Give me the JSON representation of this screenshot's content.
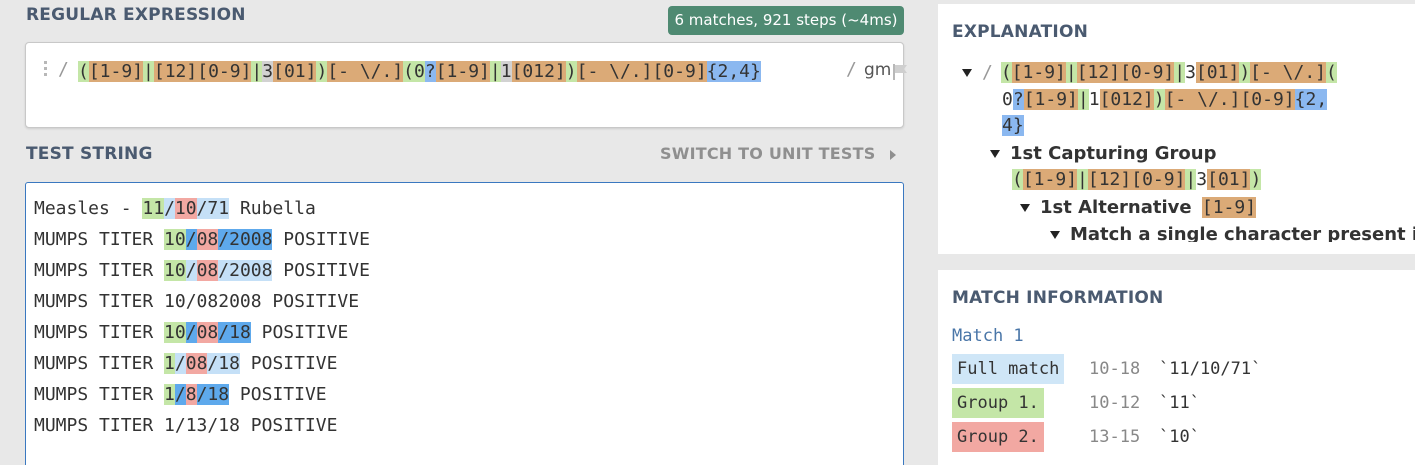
{
  "regex": {
    "title": "REGULAR EXPRESSION",
    "match_badge": "6 matches, 921 steps (~4ms)",
    "delim_open": "/",
    "delim_close": "/",
    "flags": "gm",
    "pattern_parts": [
      {
        "t": "(",
        "c": "g"
      },
      {
        "t": "[1-9]",
        "c": "o"
      },
      {
        "t": "|",
        "c": "g"
      },
      {
        "t": "[12]",
        "c": "o"
      },
      {
        "t": "[0-9]",
        "c": "o"
      },
      {
        "t": "|",
        "c": "g"
      },
      {
        "t": "3",
        "c": "x"
      },
      {
        "t": "[01]",
        "c": "o"
      },
      {
        "t": ")",
        "c": "g"
      },
      {
        "t": "[- \\/.]",
        "c": "o"
      },
      {
        "t": "(",
        "c": "g"
      },
      {
        "t": "0",
        "c": "g"
      },
      {
        "t": "?",
        "c": "b"
      },
      {
        "t": "[1-9]",
        "c": "o"
      },
      {
        "t": "|",
        "c": "g"
      },
      {
        "t": "1",
        "c": "x"
      },
      {
        "t": "[012]",
        "c": "o"
      },
      {
        "t": ")",
        "c": "g"
      },
      {
        "t": "[- \\/.]",
        "c": "o"
      },
      {
        "t": "[0-9]",
        "c": "o"
      },
      {
        "t": "{2,4}",
        "c": "b"
      }
    ]
  },
  "test": {
    "title": "TEST STRING",
    "switch_label": "SWITCH TO UNIT TESTS",
    "lines": [
      [
        {
          "t": "Measles - "
        },
        {
          "t": "11",
          "c": "g"
        },
        {
          "t": "/",
          "c": "lb"
        },
        {
          "t": "10",
          "c": "r"
        },
        {
          "t": "/71",
          "c": "lb"
        },
        {
          "t": " Rubella"
        }
      ],
      [
        {
          "t": "MUMPS TITER "
        },
        {
          "t": "10",
          "c": "g"
        },
        {
          "t": "/",
          "c": "mb"
        },
        {
          "t": "08",
          "c": "r"
        },
        {
          "t": "/2008",
          "c": "mb"
        },
        {
          "t": " POSITIVE"
        }
      ],
      [
        {
          "t": "MUMPS TITER "
        },
        {
          "t": "10",
          "c": "g"
        },
        {
          "t": "/",
          "c": "lb"
        },
        {
          "t": "08",
          "c": "r"
        },
        {
          "t": "/2008",
          "c": "lb"
        },
        {
          "t": " POSITIVE"
        }
      ],
      [
        {
          "t": "MUMPS TITER 10/082008 POSITIVE"
        }
      ],
      [
        {
          "t": "MUMPS TITER "
        },
        {
          "t": "10",
          "c": "g"
        },
        {
          "t": "/",
          "c": "mb"
        },
        {
          "t": "08",
          "c": "r"
        },
        {
          "t": "/18",
          "c": "mb"
        },
        {
          "t": " POSITIVE"
        }
      ],
      [
        {
          "t": "MUMPS TITER "
        },
        {
          "t": "1",
          "c": "g"
        },
        {
          "t": "/",
          "c": "lb"
        },
        {
          "t": "08",
          "c": "r"
        },
        {
          "t": "/18",
          "c": "lb"
        },
        {
          "t": " POSITIVE"
        }
      ],
      [
        {
          "t": "MUMPS TITER "
        },
        {
          "t": "1",
          "c": "g"
        },
        {
          "t": "/",
          "c": "mb"
        },
        {
          "t": "8",
          "c": "r"
        },
        {
          "t": "/18",
          "c": "mb"
        },
        {
          "t": " POSITIVE"
        }
      ],
      [
        {
          "t": "MUMPS TITER 1/13/18 POSITIVE"
        }
      ]
    ]
  },
  "explanation": {
    "title": "EXPLANATION",
    "slash": "/",
    "pattern_line1": [
      {
        "t": "(",
        "c": "g"
      },
      {
        "t": "[1-9]",
        "c": "o"
      },
      {
        "t": "|",
        "c": "g"
      },
      {
        "t": "[12]",
        "c": "o"
      },
      {
        "t": "[0-9]",
        "c": "o"
      },
      {
        "t": "|",
        "c": "g"
      },
      {
        "t": "3",
        "c": ""
      },
      {
        "t": "[01]",
        "c": "o"
      },
      {
        "t": ")",
        "c": "g"
      },
      {
        "t": "[- \\/.]",
        "c": "o"
      },
      {
        "t": "(",
        "c": "g"
      }
    ],
    "pattern_line2": [
      {
        "t": "0",
        "c": ""
      },
      {
        "t": "?",
        "c": "b"
      },
      {
        "t": "[1-9]",
        "c": "o"
      },
      {
        "t": "|",
        "c": "g"
      },
      {
        "t": "1",
        "c": ""
      },
      {
        "t": "[012]",
        "c": "o"
      },
      {
        "t": ")",
        "c": "g"
      },
      {
        "t": "[- \\/.]",
        "c": "o"
      },
      {
        "t": "[0-9]",
        "c": "o"
      },
      {
        "t": "{2,",
        "c": "b"
      }
    ],
    "pattern_line3": [
      {
        "t": "4}",
        "c": "b"
      }
    ],
    "capturing_group_label": "1st Capturing Group",
    "capturing_group_pattern": [
      {
        "t": "(",
        "c": "g"
      },
      {
        "t": "[1-9]",
        "c": "o"
      },
      {
        "t": "|",
        "c": "g"
      },
      {
        "t": "[12]",
        "c": "o"
      },
      {
        "t": "[0-9]",
        "c": "o"
      },
      {
        "t": "|",
        "c": "g"
      },
      {
        "t": "3",
        "c": ""
      },
      {
        "t": "[01]",
        "c": "o"
      },
      {
        "t": ")",
        "c": "g"
      }
    ],
    "alternative_label": "1st Alternative",
    "alternative_pattern": "[1-9]",
    "match_single_label": "Match a single character present i"
  },
  "match_info": {
    "title": "MATCH INFORMATION",
    "match_label": "Match 1",
    "rows": [
      {
        "tag": "Full match",
        "c": "k",
        "range": "10-18",
        "value": "`11/10/71`"
      },
      {
        "tag": "Group 1.",
        "c": "g",
        "range": "10-12",
        "value": "`11`"
      },
      {
        "tag": "Group 2.",
        "c": "r",
        "range": "13-15",
        "value": "`10`"
      }
    ]
  }
}
